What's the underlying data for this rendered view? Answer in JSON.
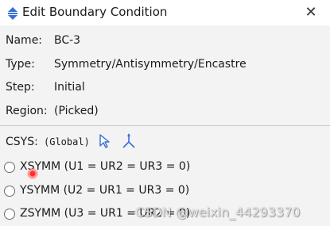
{
  "window": {
    "title": "Edit Boundary Condition",
    "title_icon": "boundary-condition-icon",
    "close_label": "✕"
  },
  "fields": {
    "name_label": "Name:",
    "name_value": "BC-3",
    "type_label": "Type:",
    "type_value": "Symmetry/Antisymmetry/Encastre",
    "step_label": "Step:",
    "step_value": "Initial",
    "region_label": "Region:",
    "region_value": "(Picked)"
  },
  "csys": {
    "label": "CSYS:",
    "value": "(Global)",
    "icons": [
      "select-arrow-icon",
      "axes-triad-icon"
    ]
  },
  "options": [
    {
      "label": "XSYMM (U1 = UR2 = UR3 = 0)",
      "selected": false
    },
    {
      "label": "YSYMM (U2 = UR1 = UR3 = 0)",
      "selected": false
    },
    {
      "label": "ZSYMM (U3 = UR1 = UR2 = 0)",
      "selected": false
    }
  ],
  "watermark": "CSDN @weixin_44293370",
  "colors": {
    "background": "#f3f3f3",
    "accent_blue": "#3a6fd8",
    "cursor_red": "#ff3030"
  }
}
